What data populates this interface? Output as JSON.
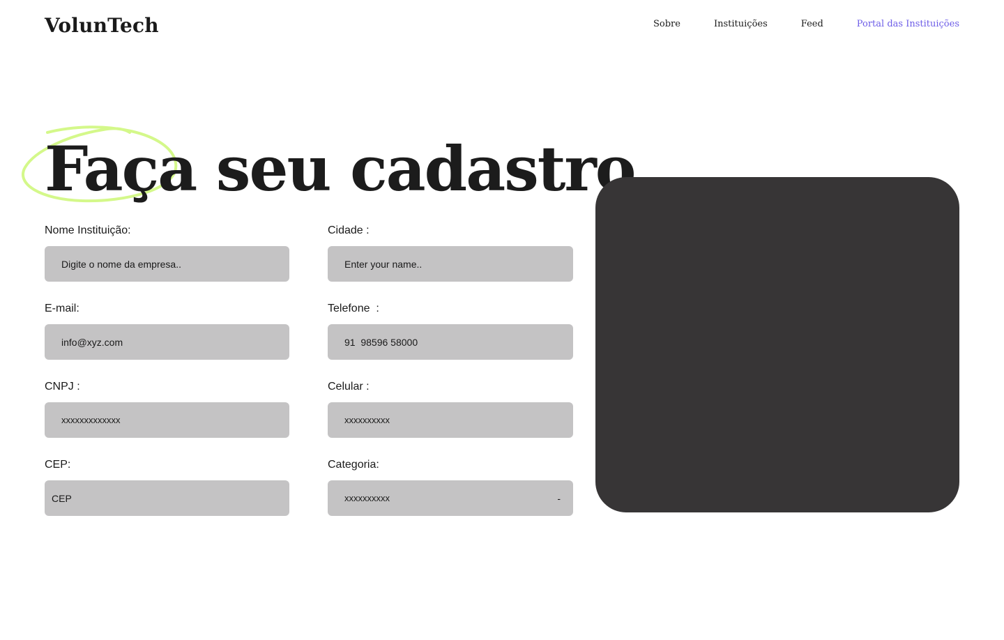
{
  "header": {
    "logo": "VolunTech",
    "nav": {
      "sobre": "Sobre",
      "instituicoes": "Instituições",
      "feed": "Feed",
      "portal": "Portal das Instituições"
    },
    "accent_color": "#6c5ce7"
  },
  "hero": {
    "title": "Faça seu cadastro",
    "highlight_color": "#d4f88a"
  },
  "form": {
    "nome": {
      "label": "Nome Instituição:",
      "placeholder": "Digite o nome da empresa.."
    },
    "cidade": {
      "label": "Cidade :",
      "placeholder": "Enter your name.."
    },
    "email": {
      "label": "E-mail:",
      "placeholder": "info@xyz.com"
    },
    "telefone": {
      "label": "Telefone  :",
      "placeholder": "91  98596 58000"
    },
    "cnpj": {
      "label": "CNPJ :",
      "placeholder": "xxxxxxxxxxxxx"
    },
    "celular": {
      "label": "Celular :",
      "placeholder": "xxxxxxxxxx"
    },
    "cep": {
      "label": "CEP:",
      "placeholder": "CEP"
    },
    "categoria": {
      "label": "Categoria:",
      "value": "xxxxxxxxxx",
      "arrow": "-"
    }
  },
  "media_panel": {
    "color": "#373536"
  }
}
